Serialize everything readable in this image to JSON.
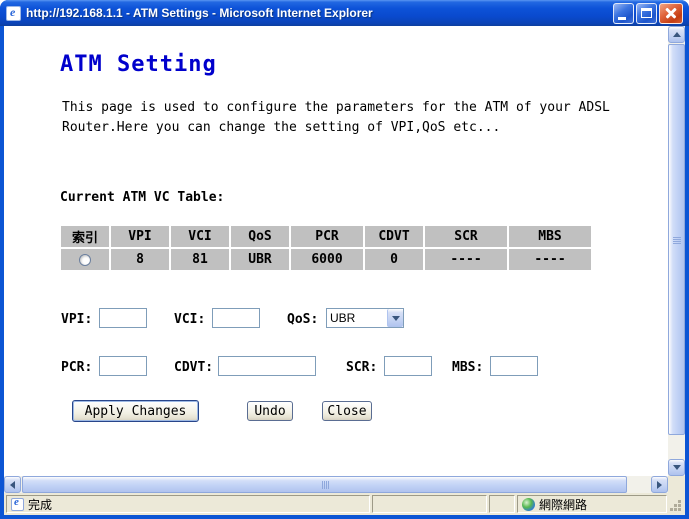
{
  "window": {
    "title": "http://192.168.1.1 - ATM Settings - Microsoft Internet Explorer"
  },
  "page": {
    "heading": "ATM Setting",
    "description": "This page is used to configure the parameters for the ATM of your ADSL Router.Here you can change the setting of VPI,QoS etc...",
    "table_title": "Current ATM VC Table:",
    "table": {
      "headers": [
        "索引",
        "VPI",
        "VCI",
        "QoS",
        "PCR",
        "CDVT",
        "SCR",
        "MBS"
      ],
      "row": [
        "8",
        "81",
        "UBR",
        "6000",
        "0",
        "----",
        "----"
      ]
    },
    "form": {
      "vpi_label": "VPI:",
      "vci_label": "VCI:",
      "qos_label": "QoS:",
      "qos_selected": "UBR",
      "pcr_label": "PCR:",
      "cdvt_label": "CDVT:",
      "scr_label": "SCR:",
      "mbs_label": "MBS:",
      "vpi_value": "",
      "vci_value": "",
      "pcr_value": "",
      "cdvt_value": "",
      "scr_value": "",
      "mbs_value": ""
    },
    "buttons": {
      "apply": "Apply Changes",
      "undo": "Undo",
      "close": "Close"
    }
  },
  "statusbar": {
    "status": "完成",
    "zone": "網際網路"
  },
  "colors": {
    "titlebar_blue": "#0d52d8",
    "heading_blue": "#0000cc",
    "table_cell_gray": "#c0c0c0",
    "statusbar_bg": "#ece9d8"
  }
}
